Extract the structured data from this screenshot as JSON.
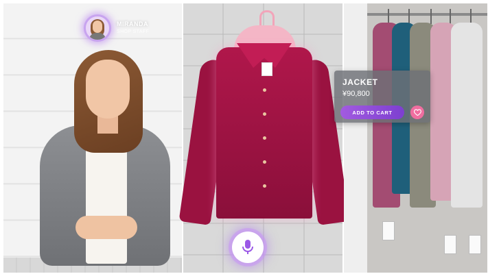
{
  "staff": {
    "name": "MIRANDA",
    "role": "SHOP STAFF",
    "avatar_icon": "person-avatar-icon"
  },
  "product": {
    "name": "JACKET",
    "price": "¥90,800",
    "add_to_cart_label": "ADD TO CART",
    "favorite_icon": "heart-icon"
  },
  "voice": {
    "icon": "microphone-icon"
  },
  "colors": {
    "accent": "#8a4ad8",
    "favorite": "#f06ea0",
    "jacket": "#a3144a"
  }
}
